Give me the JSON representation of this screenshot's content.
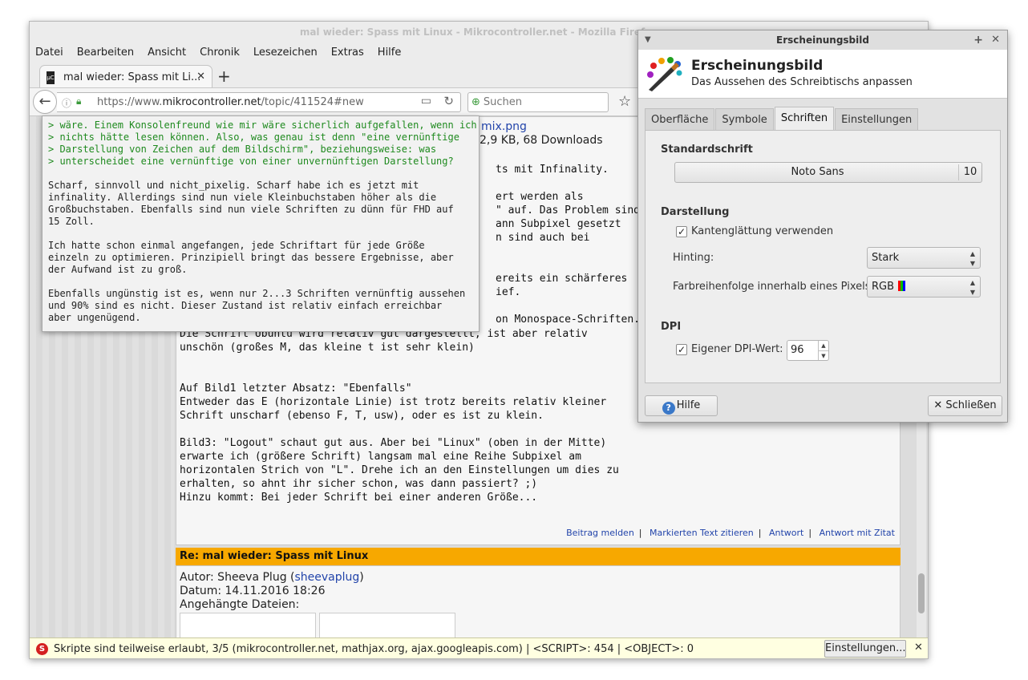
{
  "window": {
    "title": "mal wieder: Spass mit Linux - Mikrocontroller.net - Mozilla Firefox"
  },
  "menu": [
    "Datei",
    "Bearbeiten",
    "Ansicht",
    "Chronik",
    "Lesezeichen",
    "Extras",
    "Hilfe"
  ],
  "tab": {
    "label": "mal wieder: Spass mit Li...",
    "favicon": "mikrocontroller-favicon"
  },
  "nav": {
    "url_prefix": "https://www.",
    "url_domain": "mikrocontroller.net",
    "url_path": "/topic/411524#new",
    "search_placeholder": "Suchen"
  },
  "post": {
    "attachment_name": "mix.png",
    "attachment_meta": "2,9 KB, 68 Downloads",
    "body_right": "ts mit Infinality.\n\nert werden als\n\" auf. Das Problem sind\nann Subpixel gesetzt\nn sind auch bei\n\n\nereits ein schärferes\nief.\n\non Monospace-Schriften.",
    "body_main": "Die Schrift Ubuntu wird relativ gut dargestellt, ist aber relativ\nunschön (großes M, das kleine t ist sehr klein)\n\n\nAuf Bild1 letzter Absatz: \"Ebenfalls\"\nEntweder das E (horizontale Linie) ist trotz bereits relativ kleiner\nSchrift unscharf (ebenso F, T, usw), oder es ist zu klein.\n\nBild3: \"Logout\" schaut gut aus. Aber bei \"Linux\" (oben in der Mitte)\nerwarte ich (größere Schrift) langsam mal eine Reihe Subpixel am\nhorizontalen Strich von \"L\". Drehe ich an den Einstellungen um dies zu\nerhalten, so ahnt ihr sicher schon, was dann passiert? ;)\nHinzu kommt: Bei jeder Schrift bei einer anderen Größe...",
    "links": [
      "Beitrag melden",
      "Markierten Text zitieren",
      "Antwort",
      "Antwort mit Zitat"
    ]
  },
  "post2": {
    "header": "Re: mal wieder: Spass mit Linux",
    "author_label": "Autor: Sheeva Plug (",
    "author_user": "sheevaplug",
    "author_close": ")",
    "date": "Datum: 14.11.2016 18:26",
    "attachments_label": "Angehängte Dateien:"
  },
  "quote": {
    "quoted": "> wäre. Einem Konsolenfreund wie mir wäre sicherlich aufgefallen, wenn ich\n> nichts hätte lesen können. Also, was genau ist denn \"eine vernünftige\n> Darstellung von Zeichen auf dem Bildschirm\", beziehungsweise: was\n> unterscheidet eine vernünftige von einer unvernünftigen Darstellung?",
    "reply": "Scharf, sinnvoll und nicht_pixelig. Scharf habe ich es jetzt mit\ninfinality. Allerdings sind nun viele Kleinbuchstaben höher als die\nGroßbuchstaben. Ebenfalls sind nun viele Schriften zu dünn für FHD auf\n15 Zoll.\n\nIch hatte schon einmal angefangen, jede Schriftart für jede Größe\neinzeln zu optimieren. Prinzipiell bringt das bessere Ergebnisse, aber\nder Aufwand ist zu groß.\n\nEbenfalls ungünstig ist es, wenn nur 2...3 Schriften vernünftig aussehen\nund 90% sind es nicht. Dieser Zustand ist relativ einfach erreichbar\naber ungenügend."
  },
  "statusbar": {
    "text": "Skripte sind teilweise erlaubt, 3/5 (mikrocontroller.net, mathjax.org, ajax.googleapis.com) | <SCRIPT>: 454 | <OBJECT>: 0",
    "button": "Einstellungen..."
  },
  "dialog": {
    "title": "Erscheinungsbild",
    "heading": "Erscheinungsbild",
    "subheading": "Das Aussehen des Schreibtischs anpassen",
    "tabs": [
      "Oberfläche",
      "Symbole",
      "Schriften",
      "Einstellungen"
    ],
    "active_tab": "Schriften",
    "standard_section": "Standardschrift",
    "font_name": "Noto Sans",
    "font_size": "10",
    "display_section": "Darstellung",
    "antialias_label": "Kantenglättung verwenden",
    "antialias_checked": true,
    "hinting_label": "Hinting:",
    "hinting_value": "Stark",
    "subpixel_label": "Farbreihenfolge innerhalb eines Pixels:",
    "subpixel_value": "RGB",
    "subpixel_colors": [
      "#ff0000",
      "#00c000",
      "#0000ff"
    ],
    "dpi_section": "DPI",
    "dpi_label": "Eigener DPI-Wert:",
    "dpi_checked": true,
    "dpi_value": "96",
    "help_button": "Hilfe",
    "close_button": "Schließen"
  }
}
